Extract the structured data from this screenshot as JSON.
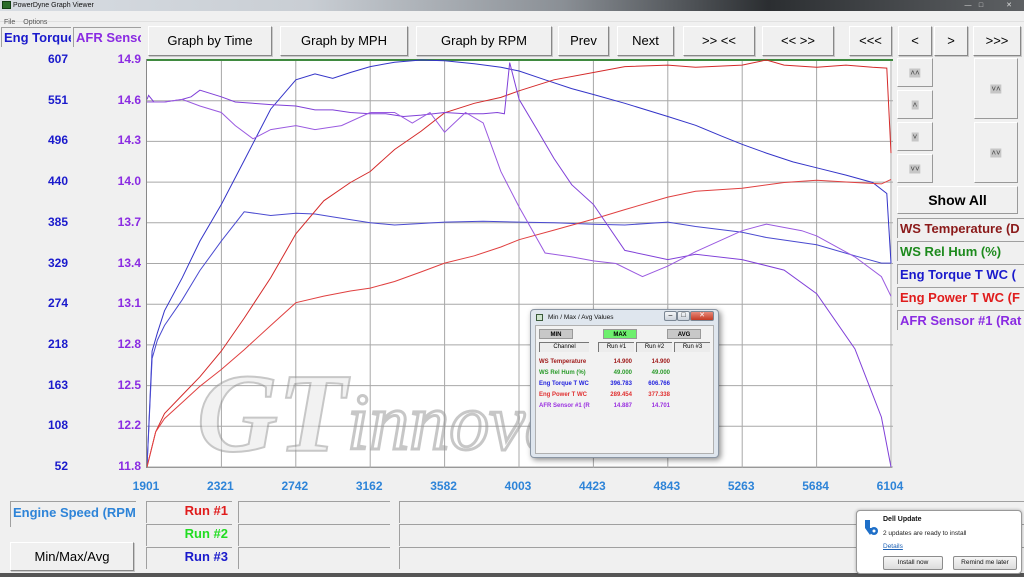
{
  "window": {
    "title": "PowerDyne Graph Viewer",
    "minimize": "—",
    "maximize": "□",
    "close": "✕"
  },
  "menu": [
    "File",
    "Options"
  ],
  "channel_headers": {
    "left": "Eng Torque",
    "right": "AFR Sensor"
  },
  "toolbar": {
    "graph_by_time": "Graph by Time",
    "graph_by_mph": "Graph by MPH",
    "graph_by_rpm": "Graph by RPM",
    "prev": "Prev",
    "next": "Next",
    "zoom_in": ">> <<",
    "zoom_out": "<< >>",
    "first": "<<<",
    "back": "<",
    "forward": ">",
    "last": ">>>"
  },
  "scroll_buttons": {
    "page_up": "˄˄",
    "up": "˄",
    "down": "˅",
    "page_down": "˅˅",
    "expand": "˅˄",
    "collapse": "˄˅"
  },
  "show_all": "Show All",
  "legend": [
    {
      "label": "WS Temperature (D",
      "color": "#8b1a1a"
    },
    {
      "label": "WS Rel Hum (%)",
      "color": "#1d8a1d"
    },
    {
      "label": "Eng Torque T WC (",
      "color": "#1a1acc"
    },
    {
      "label": "Eng Power T WC (F",
      "color": "#e01c1c"
    },
    {
      "label": "AFR Sensor #1 (Rat",
      "color": "#8a2be2"
    }
  ],
  "x_axis_label": "Engine Speed (RPM",
  "min_max_button": "Min/Max/Avg",
  "runs": [
    {
      "label": "Run #1",
      "color": "#e01c1c"
    },
    {
      "label": "Run #2",
      "color": "#22dd22"
    },
    {
      "label": "Run #3",
      "color": "#1a1acc"
    }
  ],
  "min_max_dialog": {
    "title": "Min / Max / Avg Values",
    "buttons": {
      "min": "MIN",
      "max": "MAX",
      "avg": "AVG"
    },
    "active": "MAX",
    "columns": [
      "Channel",
      "Run #1",
      "Run #2",
      "Run #3"
    ],
    "rows": [
      {
        "channel": "WS Temperature",
        "run1": "14.900",
        "run2": "14.900",
        "run3": "",
        "color": "#a01c1c"
      },
      {
        "channel": "WS Rel Hum (%)",
        "run1": "49.000",
        "run2": "49.000",
        "run3": "",
        "color": "#2a9a2a"
      },
      {
        "channel": "Eng Torque T WC",
        "run1": "396.783",
        "run2": "606.766",
        "run3": "",
        "color": "#2222dd"
      },
      {
        "channel": "Eng Power T WC",
        "run1": "289.454",
        "run2": "377.338",
        "run3": "",
        "color": "#e03030"
      },
      {
        "channel": "AFR Sensor #1 (R",
        "run1": "14.887",
        "run2": "14.701",
        "run3": "",
        "color": "#9a30e0"
      }
    ]
  },
  "watermark": "GTinnovation",
  "toast": {
    "title": "Dell Update",
    "message": "2 updates are ready to install",
    "link": "Details",
    "install": "Install now",
    "remind": "Remind me later"
  },
  "chart_data": {
    "type": "line",
    "title": "",
    "xlabel": "Engine Speed (RPM",
    "ylabel_left": "Eng Torque",
    "ylabel_right": "AFR Sensor",
    "x_ticks": [
      1901,
      2321,
      2742,
      3162,
      3582,
      4003,
      4423,
      4843,
      5263,
      5684,
      6104
    ],
    "y_left_ticks": [
      52,
      108,
      163,
      218,
      274,
      329,
      385,
      440,
      496,
      551,
      607
    ],
    "y_right_ticks": [
      "11.8",
      "12.2",
      "12.5",
      "12.8",
      "13.1",
      "13.4",
      "13.7",
      "14.0",
      "14.3",
      "14.6",
      "14.9"
    ],
    "xlim": [
      1901,
      6104
    ],
    "ylim_left": [
      52,
      607
    ],
    "ylim_right": [
      11.8,
      14.9
    ],
    "grid": true,
    "legend": "right",
    "series": [
      {
        "name": "Eng Torque T WC Run #2",
        "axis": "left",
        "color": "#3434c8",
        "x": [
          1901,
          1930,
          1960,
          2000,
          2100,
          2200,
          2321,
          2450,
          2600,
          2742,
          2850,
          2950,
          3050,
          3162,
          3300,
          3450,
          3582,
          3750,
          3900,
          4003,
          4150,
          4300,
          4423,
          4600,
          4843,
          5000,
          5150,
          5263,
          5400,
          5550,
          5684,
          5850,
          6000,
          6080,
          6104
        ],
        "y": [
          52,
          210,
          235,
          265,
          310,
          360,
          410,
          470,
          540,
          580,
          588,
          582,
          590,
          598,
          604,
          607,
          606,
          602,
          597,
          592,
          580,
          568,
          560,
          548,
          530,
          518,
          503,
          492,
          480,
          468,
          460,
          450,
          440,
          425,
          330
        ]
      },
      {
        "name": "Eng Torque T WC Run #1",
        "axis": "left",
        "color": "#4a4ad0",
        "x": [
          1901,
          1930,
          1960,
          2000,
          2100,
          2200,
          2321,
          2450,
          2600,
          2742,
          2850,
          2950,
          3162,
          3300,
          3450,
          3582,
          3800,
          4003,
          4200,
          4423,
          4600,
          4843,
          5000,
          5263,
          5400,
          5684,
          5900,
          6050,
          6104
        ],
        "y": [
          52,
          200,
          225,
          245,
          280,
          320,
          360,
          400,
          395,
          398,
          397,
          393,
          385,
          382,
          384,
          386,
          387,
          386,
          385,
          383,
          382,
          386,
          380,
          372,
          365,
          355,
          340,
          330,
          330
        ]
      },
      {
        "name": "Eng Power T WC Run #2",
        "axis": "left",
        "color": "#d42a2a",
        "x": [
          1901,
          1950,
          2000,
          2100,
          2200,
          2321,
          2450,
          2600,
          2742,
          2900,
          3050,
          3162,
          3300,
          3450,
          3582,
          3750,
          3900,
          4003,
          4200,
          4423,
          4600,
          4843,
          5000,
          5263,
          5400,
          5500,
          5684,
          5850,
          6000,
          6080,
          6104
        ],
        "y": [
          52,
          100,
          125,
          150,
          175,
          210,
          255,
          310,
          370,
          415,
          440,
          455,
          485,
          510,
          535,
          548,
          556,
          565,
          580,
          590,
          598,
          600,
          597,
          600,
          607,
          600,
          597,
          600,
          597,
          596,
          480
        ]
      },
      {
        "name": "Eng Power T WC Run #1",
        "axis": "left",
        "color": "#e04040",
        "x": [
          1901,
          1950,
          2000,
          2100,
          2200,
          2321,
          2450,
          2600,
          2742,
          2900,
          3050,
          3162,
          3300,
          3450,
          3582,
          3750,
          3900,
          4003,
          4200,
          4423,
          4600,
          4843,
          5000,
          5263,
          5500,
          5684,
          5900,
          6050,
          6104
        ],
        "y": [
          52,
          100,
          118,
          140,
          162,
          185,
          212,
          245,
          276,
          285,
          292,
          296,
          305,
          318,
          330,
          340,
          352,
          362,
          375,
          390,
          403,
          420,
          428,
          432,
          440,
          443,
          440,
          438,
          444
        ]
      },
      {
        "name": "AFR Sensor #1 Run #2",
        "axis": "right",
        "color": "#8040d8",
        "x": [
          1901,
          1910,
          1940,
          2000,
          2100,
          2150,
          2200,
          2321,
          2400,
          2500,
          2600,
          2742,
          2850,
          2950,
          3050,
          3162,
          3250,
          3350,
          3450,
          3582,
          3700,
          3800,
          3880,
          3920,
          3950,
          4003,
          4100,
          4200,
          4300,
          4423,
          4600,
          4843,
          5000,
          5263,
          5500,
          5684,
          5900,
          6050,
          6104
        ],
        "y": [
          14.6,
          14.63,
          14.58,
          14.58,
          14.6,
          14.62,
          14.67,
          14.62,
          14.58,
          14.57,
          14.56,
          14.55,
          14.52,
          14.52,
          14.5,
          14.49,
          14.49,
          14.47,
          14.48,
          14.5,
          14.49,
          14.49,
          14.5,
          14.49,
          14.88,
          14.6,
          14.38,
          14.15,
          13.95,
          13.8,
          13.45,
          13.38,
          13.42,
          13.38,
          13.3,
          13.12,
          12.7,
          12.18,
          11.8
        ]
      },
      {
        "name": "AFR Sensor #1 Run #1",
        "axis": "right",
        "color": "#9a5ae0",
        "x": [
          1901,
          1950,
          2000,
          2100,
          2200,
          2321,
          2400,
          2500,
          2600,
          2742,
          2850,
          3000,
          3162,
          3300,
          3400,
          3500,
          3582,
          3700,
          3800,
          3900,
          4003,
          4150,
          4300,
          4423,
          4550,
          4700,
          4843,
          5000,
          5263,
          5400,
          5600,
          5684,
          5900,
          6050,
          6104
        ],
        "y": [
          14.58,
          14.58,
          14.58,
          14.6,
          14.55,
          14.5,
          14.4,
          14.3,
          14.37,
          14.4,
          14.37,
          14.4,
          14.5,
          14.5,
          14.42,
          14.5,
          14.35,
          14.5,
          14.42,
          14.05,
          13.78,
          13.43,
          13.4,
          13.37,
          13.35,
          13.25,
          13.33,
          13.44,
          13.6,
          13.65,
          13.6,
          13.56,
          13.4,
          13.25,
          13.1
        ]
      }
    ]
  }
}
